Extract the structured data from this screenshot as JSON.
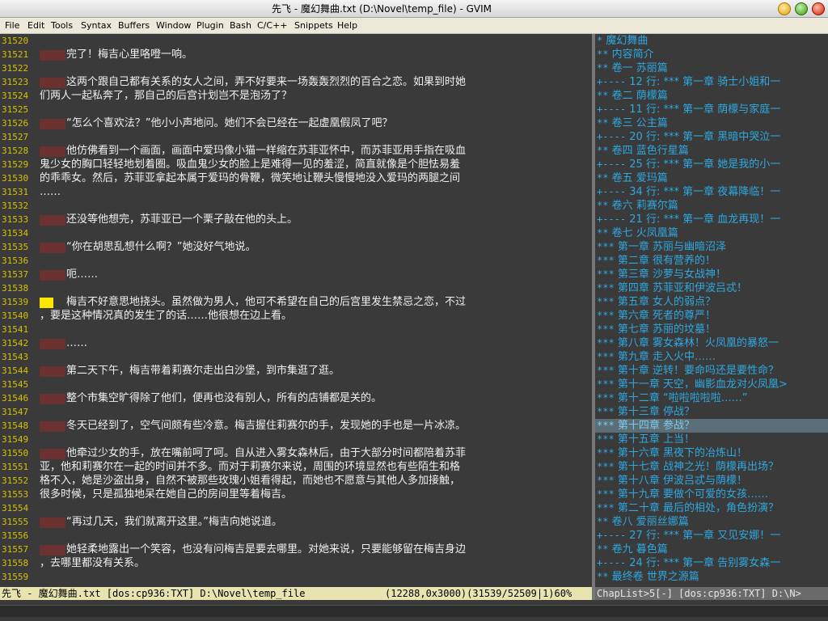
{
  "window": {
    "title": "先飞 - 魔幻舞曲.txt (D:\\Novel\\temp_file) - GVIM"
  },
  "menu": [
    {
      "label": "File"
    },
    {
      "label": "Edit"
    },
    {
      "label": "Tools"
    },
    {
      "label": "Syntax"
    },
    {
      "label": "Buffers"
    },
    {
      "label": "Window"
    },
    {
      "label": "Plugin"
    },
    {
      "label": "Bash"
    },
    {
      "label": "C/C++"
    },
    {
      "label": "Snippets"
    },
    {
      "label": "Help"
    }
  ],
  "editor": {
    "lines": [
      {
        "num": "31520",
        "text": "",
        "indent": false
      },
      {
        "num": "31521",
        "text": "完了！梅吉心里咯噔一响。",
        "indent": true
      },
      {
        "num": "31522",
        "text": "",
        "indent": false
      },
      {
        "num": "31523",
        "text": "这两个跟自己都有关系的女人之间，弄不好要来一场轰轰烈烈的百合之恋。如果到时她",
        "indent": true
      },
      {
        "num": "31524",
        "text": "们两人一起私奔了，那自己的后宫计划岂不是泡汤了？",
        "indent": false
      },
      {
        "num": "31525",
        "text": "",
        "indent": false
      },
      {
        "num": "31526",
        "text": "“怎么个喜欢法？”他小小声地问。她们不会已经在一起虚凰假凤了吧？",
        "indent": true
      },
      {
        "num": "31527",
        "text": "",
        "indent": false
      },
      {
        "num": "31528",
        "text": "他仿佛看到一个画面，画面中爱玛像小猫一样缩在苏菲亚怀中，而苏菲亚用手指在吸血",
        "indent": true
      },
      {
        "num": "31529",
        "text": "鬼少女的胸口轻轻地划着圈。吸血鬼少女的脸上是难得一见的羞涩，简直就像是个胆怯易羞",
        "indent": false
      },
      {
        "num": "31530",
        "text": "的乖乖女。然后，苏菲亚拿起本属于爱玛的骨鞭，微笑地让鞭头慢慢地没入爱玛的两腿之间",
        "indent": false
      },
      {
        "num": "31531",
        "text": "……",
        "indent": false
      },
      {
        "num": "31532",
        "text": "",
        "indent": false
      },
      {
        "num": "31533",
        "text": "还没等他想完，苏菲亚已一个栗子敲在他的头上。",
        "indent": true
      },
      {
        "num": "31534",
        "text": "",
        "indent": false
      },
      {
        "num": "31535",
        "text": "“你在胡思乱想什么啊？”她没好气地说。",
        "indent": true
      },
      {
        "num": "31536",
        "text": "",
        "indent": false
      },
      {
        "num": "31537",
        "text": "呃……",
        "indent": true
      },
      {
        "num": "31538",
        "text": "",
        "indent": false
      },
      {
        "num": "31539",
        "text": "梅吉不好意思地挠头。虽然做为男人，他可不希望在自己的后宫里发生禁忌之恋，不过",
        "indent": true,
        "cursor": true
      },
      {
        "num": "31540",
        "text": "，要是这种情况真的发生了的话……他很想在边上看。",
        "indent": false
      },
      {
        "num": "31541",
        "text": "",
        "indent": false
      },
      {
        "num": "31542",
        "text": "……",
        "indent": true
      },
      {
        "num": "31543",
        "text": "",
        "indent": false
      },
      {
        "num": "31544",
        "text": "第二天下午，梅吉带着莉赛尔走出白沙堡，到市集逛了逛。",
        "indent": true
      },
      {
        "num": "31545",
        "text": "",
        "indent": false
      },
      {
        "num": "31546",
        "text": "整个市集空旷得除了他们，便再也没有别人，所有的店铺都是关的。",
        "indent": true
      },
      {
        "num": "31547",
        "text": "",
        "indent": false
      },
      {
        "num": "31548",
        "text": "冬天已经到了，空气间颇有些冷意。梅吉握住莉赛尔的手，发现她的手也是一片冰凉。",
        "indent": true
      },
      {
        "num": "31549",
        "text": "",
        "indent": false
      },
      {
        "num": "31550",
        "text": "他牵过少女的手，放在嘴前呵了呵。自从进入雾女森林后，由于大部分时间都陪着苏菲",
        "indent": true
      },
      {
        "num": "31551",
        "text": "亚，他和莉赛尔在一起的时间并不多。而对于莉赛尔来说，周围的环境显然也有些陌生和格",
        "indent": false
      },
      {
        "num": "31552",
        "text": "格不入，她是沙盗出身，自然不被那些玫瑰小姐看得起，而她也不愿意与其他人多加接触，",
        "indent": false
      },
      {
        "num": "31553",
        "text": "很多时候，只是孤独地呆在她自己的房间里等着梅吉。",
        "indent": false
      },
      {
        "num": "31554",
        "text": "",
        "indent": false
      },
      {
        "num": "31555",
        "text": "“再过几天，我们就离开这里。”梅吉向她说道。",
        "indent": true
      },
      {
        "num": "31556",
        "text": "",
        "indent": false
      },
      {
        "num": "31557",
        "text": "她轻柔地露出一个笑容，也没有问梅吉是要去哪里。对她来说，只要能够留在梅吉身边",
        "indent": true
      },
      {
        "num": "31558",
        "text": "，去哪里都没有关系。",
        "indent": false
      },
      {
        "num": "31559",
        "text": "",
        "indent": false
      }
    ]
  },
  "sidebar": {
    "items": [
      {
        "prefix": "*",
        "text": "魔幻舞曲"
      },
      {
        "prefix": "**",
        "text": "内容简介"
      },
      {
        "prefix": "**",
        "text": "卷一 苏丽篇"
      },
      {
        "prefix": "+----",
        "text": "12 行: *** 第一章 骑士小姐和一"
      },
      {
        "prefix": "**",
        "text": "卷二 荫檬篇"
      },
      {
        "prefix": "+----",
        "text": "11 行: *** 第一章 荫檬与家庭一"
      },
      {
        "prefix": "**",
        "text": "卷三 公主篇"
      },
      {
        "prefix": "+----",
        "text": "20 行: *** 第一章 黑暗中哭泣一"
      },
      {
        "prefix": "**",
        "text": "卷四 蓝色行星篇"
      },
      {
        "prefix": "+----",
        "text": "25 行: *** 第一章 她是我的小一"
      },
      {
        "prefix": "**",
        "text": "卷五 爱玛篇"
      },
      {
        "prefix": "+----",
        "text": "34 行: *** 第一章 夜幕降临！一"
      },
      {
        "prefix": "**",
        "text": "卷六 莉赛尔篇"
      },
      {
        "prefix": "+----",
        "text": "21 行: *** 第一章 血龙再现！一"
      },
      {
        "prefix": "**",
        "text": "卷七 火凤凰篇"
      },
      {
        "prefix": "***",
        "text": "第一章 苏丽与幽暗沼泽"
      },
      {
        "prefix": "***",
        "text": "第二章 很有营养的！"
      },
      {
        "prefix": "***",
        "text": "第三章 沙萝与女战神！"
      },
      {
        "prefix": "***",
        "text": "第四章 苏菲亚和伊波吕忒！"
      },
      {
        "prefix": "***",
        "text": "第五章 女人的弱点？"
      },
      {
        "prefix": "***",
        "text": "第六章 死者的尊严！"
      },
      {
        "prefix": "***",
        "text": "第七章 苏丽的坟墓！"
      },
      {
        "prefix": "***",
        "text": "第八章 雾女森林！火凤凰的暴怒一"
      },
      {
        "prefix": "***",
        "text": "第九章 走入火中……"
      },
      {
        "prefix": "***",
        "text": "第十章 逆转！要命吗还是要性命？"
      },
      {
        "prefix": "***",
        "text": "第十一章 天空，幽影血龙对火凤凰>"
      },
      {
        "prefix": "***",
        "text": "第十二章 “啦啦啦啦啦……”"
      },
      {
        "prefix": "***",
        "text": "第十三章 停战？"
      },
      {
        "prefix": "***",
        "text": "第十四章 参战？",
        "highlight": true
      },
      {
        "prefix": "***",
        "text": "第十五章 上当！"
      },
      {
        "prefix": "***",
        "text": "第十六章 黑夜下的冶炼山！"
      },
      {
        "prefix": "***",
        "text": "第十七章 战神之光！荫檬再出场？"
      },
      {
        "prefix": "***",
        "text": "第十八章 伊波吕忒与荫檬！"
      },
      {
        "prefix": "***",
        "text": "第十九章 要做个可爱的女孩……"
      },
      {
        "prefix": "***",
        "text": "第二十章 最后的相处，角色扮演？"
      },
      {
        "prefix": "**",
        "text": "卷八 爱丽丝娜篇"
      },
      {
        "prefix": "+----",
        "text": "27 行: *** 第一章 又见安娜！一"
      },
      {
        "prefix": "**",
        "text": "卷九 暮色篇"
      },
      {
        "prefix": "+----",
        "text": "24 行: *** 第一章 告别雾女森一"
      },
      {
        "prefix": "**",
        "text": "最终卷 世界之源篇"
      }
    ]
  },
  "status": {
    "file": "先飞 - 魔幻舞曲.txt [dos:cp936:TXT] D:\\Novel\\temp_file",
    "position": "(12288,0x3000)(31539/52509|1)60%",
    "sidebar": "ChapList>5[-] [dos:cp936:TXT] D:\\N>"
  },
  "colors": {
    "editor_bg": "#3a3a3a",
    "line_number": "#d6c000",
    "indent_mark": "#6b3030",
    "cursor": "#ffe600",
    "sidebar_text": "#2ea8e0",
    "status_bg": "#e8e4b0"
  }
}
